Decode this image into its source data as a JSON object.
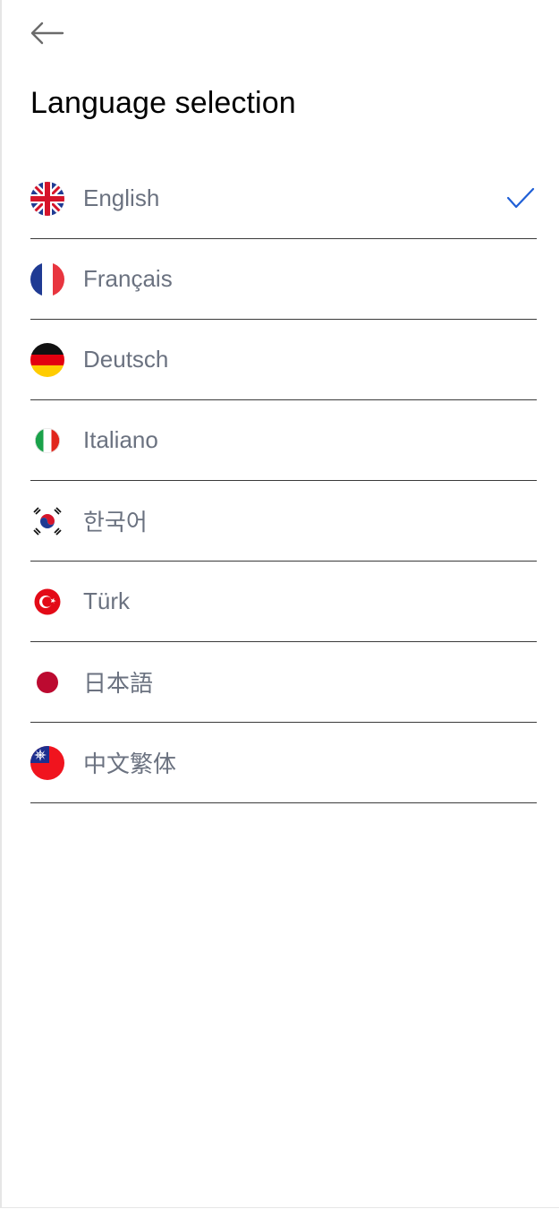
{
  "header": {
    "back_icon": "arrow-left-icon",
    "title": "Language selection"
  },
  "colors": {
    "text_primary": "#000000",
    "text_secondary": "#6b7280",
    "accent_check": "#1f5fd6",
    "divider": "#3a3a3a"
  },
  "languages": [
    {
      "label": "English",
      "flag_icon": "uk-flag-icon",
      "selected": true
    },
    {
      "label": "Français",
      "flag_icon": "france-flag-icon",
      "selected": false
    },
    {
      "label": "Deutsch",
      "flag_icon": "germany-flag-icon",
      "selected": false
    },
    {
      "label": "Italiano",
      "flag_icon": "italy-flag-icon",
      "selected": false
    },
    {
      "label": "한국어",
      "flag_icon": "south-korea-flag-icon",
      "selected": false
    },
    {
      "label": "Türk",
      "flag_icon": "turkey-flag-icon",
      "selected": false
    },
    {
      "label": "日本語",
      "flag_icon": "japan-flag-icon",
      "selected": false
    },
    {
      "label": "中文繁体",
      "flag_icon": "taiwan-flag-icon",
      "selected": false
    }
  ]
}
